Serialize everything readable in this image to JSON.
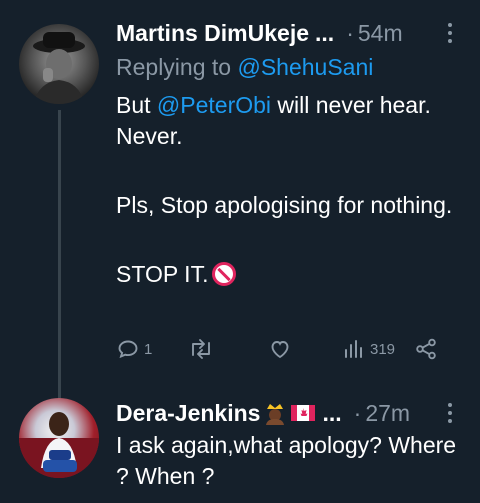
{
  "tweets": [
    {
      "author": "Martins DimUkeje",
      "ellipsis": "...",
      "separator": "·",
      "time": "54m",
      "replying_prefix": "Replying to ",
      "replying_handle": "@ShehuSani",
      "body": {
        "line1_prefix": "But ",
        "line1_mention": "@PeterObi",
        "line1_suffix": " will never hear.",
        "line2": "Never.",
        "paragraph2": "Pls, Stop apologising for nothing.",
        "paragraph3": "STOP IT."
      },
      "stats": {
        "replies": "1",
        "views": "319"
      }
    },
    {
      "author": "Dera-Jenkins",
      "ellipsis": "...",
      "separator": "·",
      "time": "27m",
      "body": "I ask again,what apology? Where ? When ?"
    }
  ],
  "icons": {
    "reply": "reply-icon",
    "retweet": "retweet-icon",
    "like": "heart-icon",
    "views": "views-icon",
    "share": "share-icon",
    "more": "more-options-icon",
    "no_entry": "no-entry-emoji",
    "prince": "prince-emoji",
    "flag": "canada-flag-emoji"
  },
  "colors": {
    "background": "#15202b",
    "text": "#ffffff",
    "muted": "#8b98a5",
    "link": "#1d9bf0"
  }
}
